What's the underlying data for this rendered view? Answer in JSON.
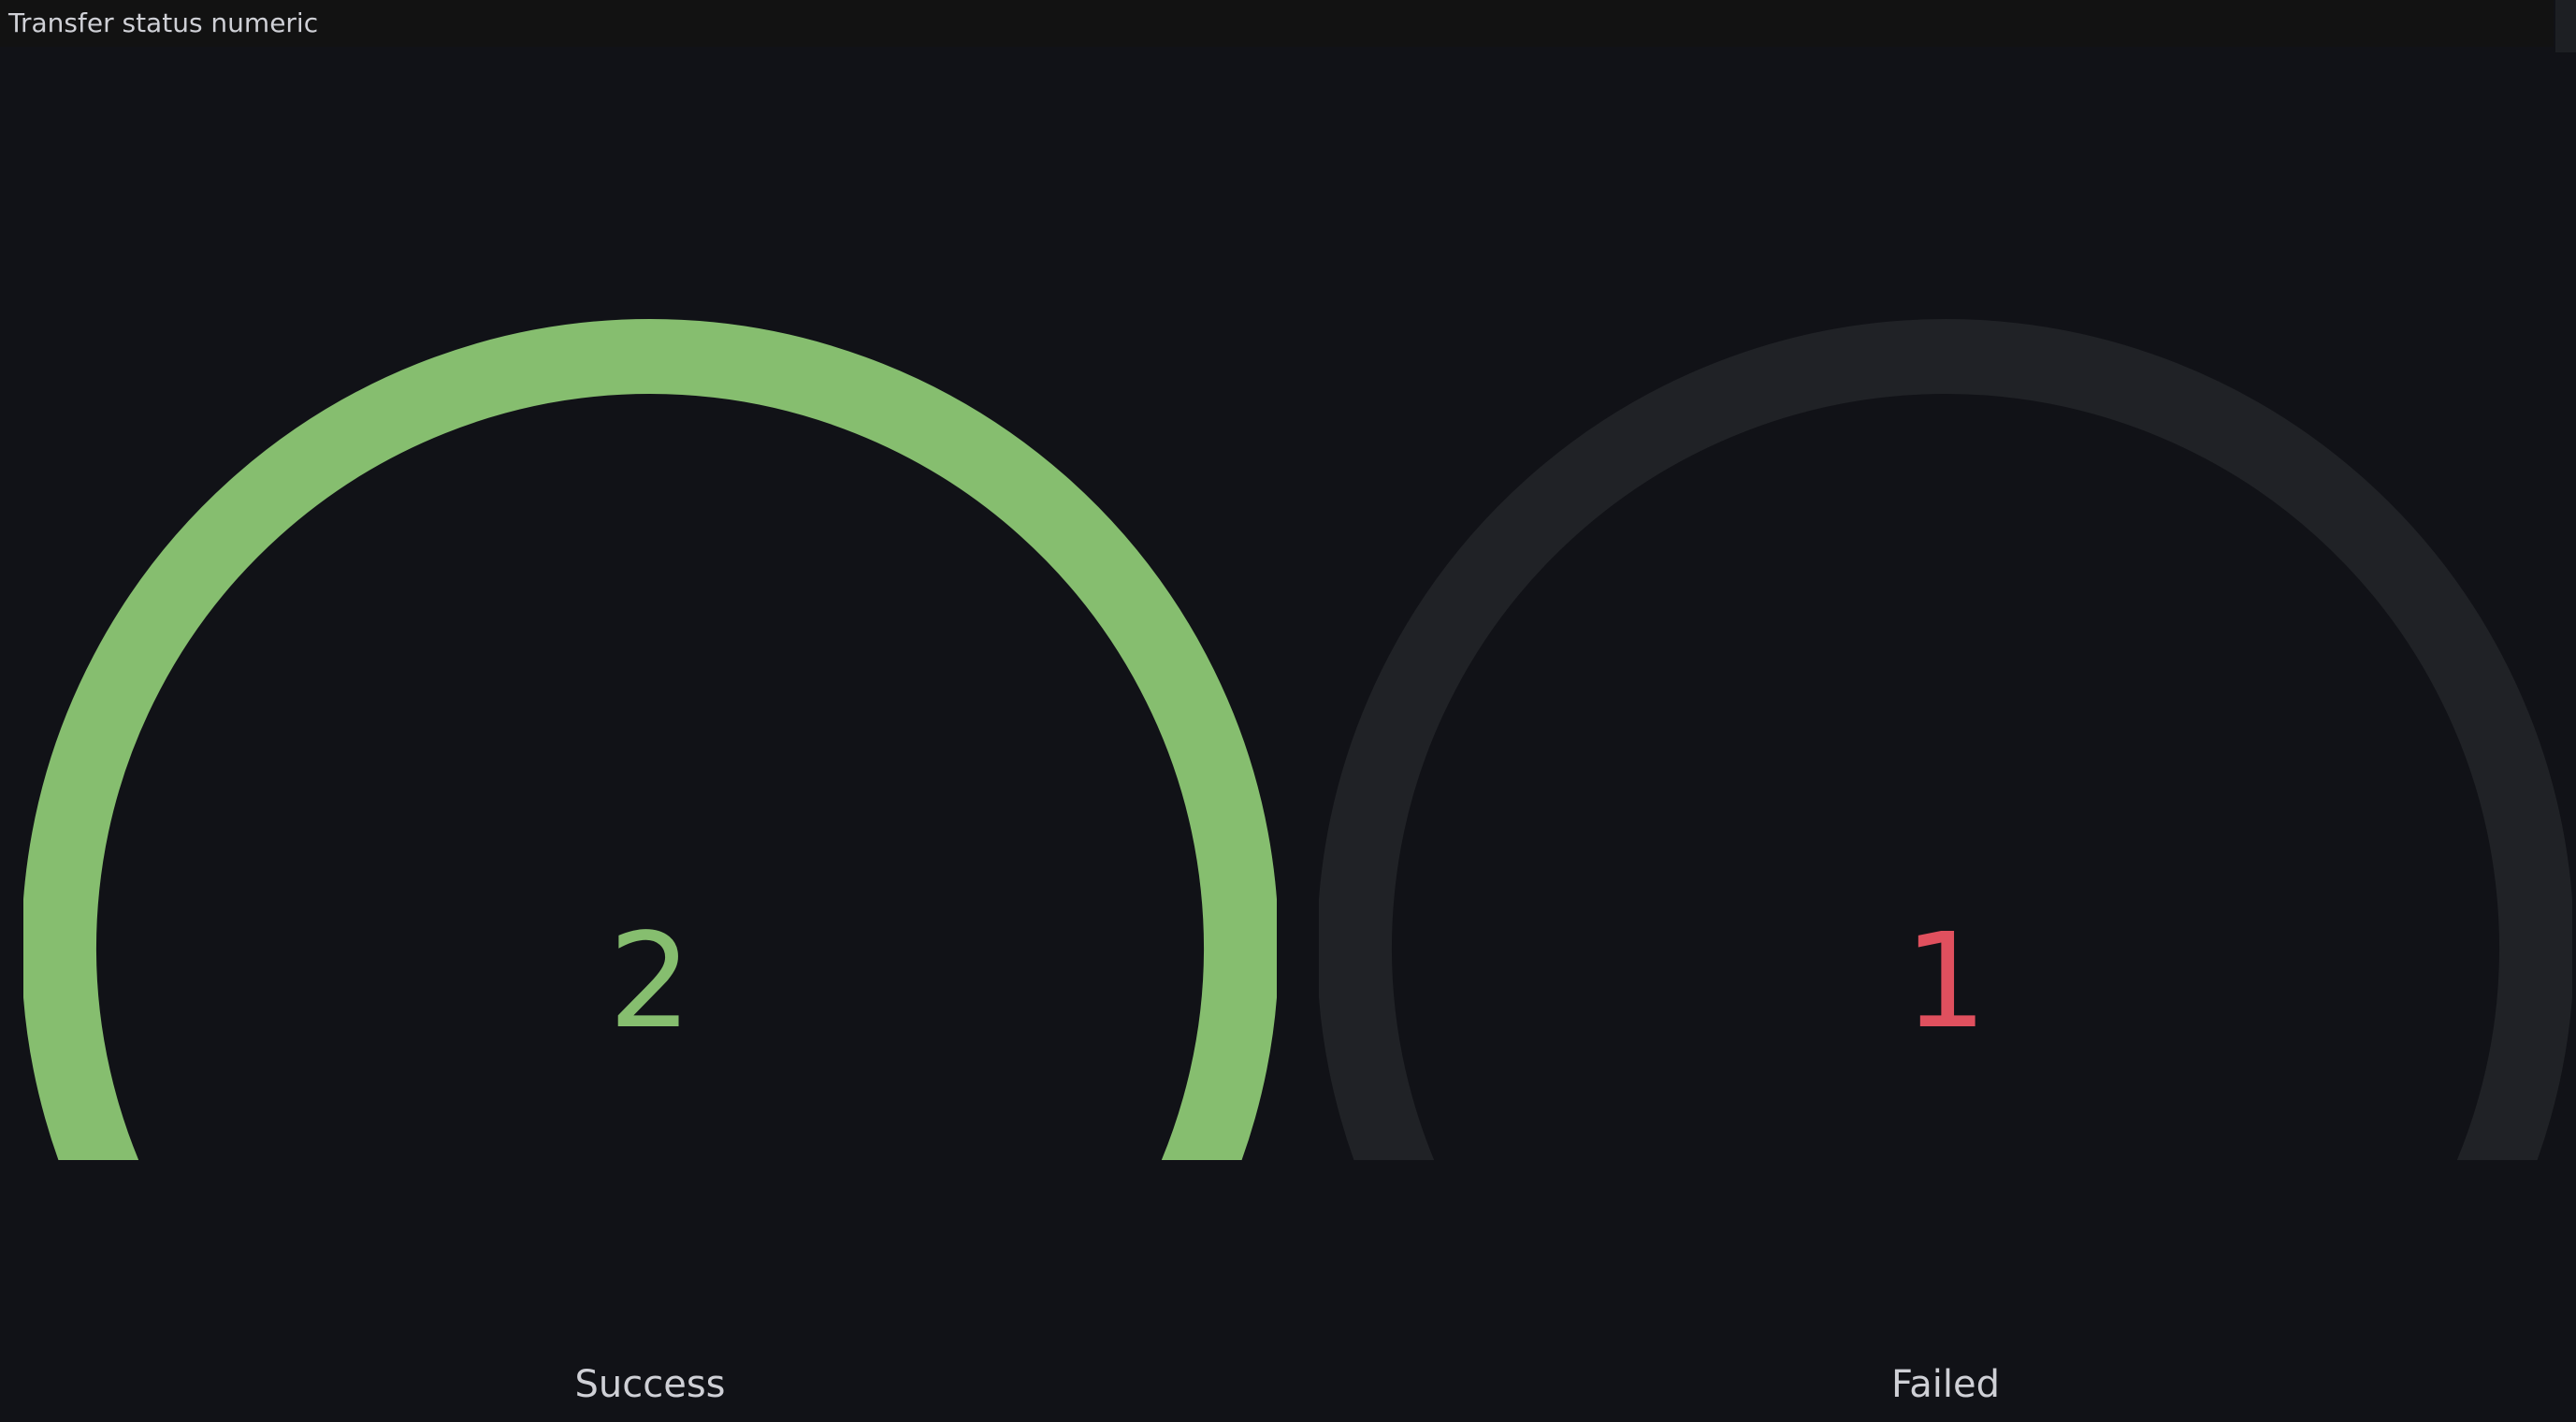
{
  "panel": {
    "title": "Transfer status numeric"
  },
  "gauges": [
    {
      "label": "Success",
      "value": "2",
      "fill_fraction": 1.0,
      "arc_color": "#86be6f",
      "value_color": "#86be6f"
    },
    {
      "label": "Failed",
      "value": "1",
      "fill_fraction": 0.0,
      "arc_color": "#202226",
      "value_color": "#e0505e"
    }
  ],
  "colors": {
    "background": "#111217",
    "track": "#202226",
    "text": "#cfd0d6"
  }
}
